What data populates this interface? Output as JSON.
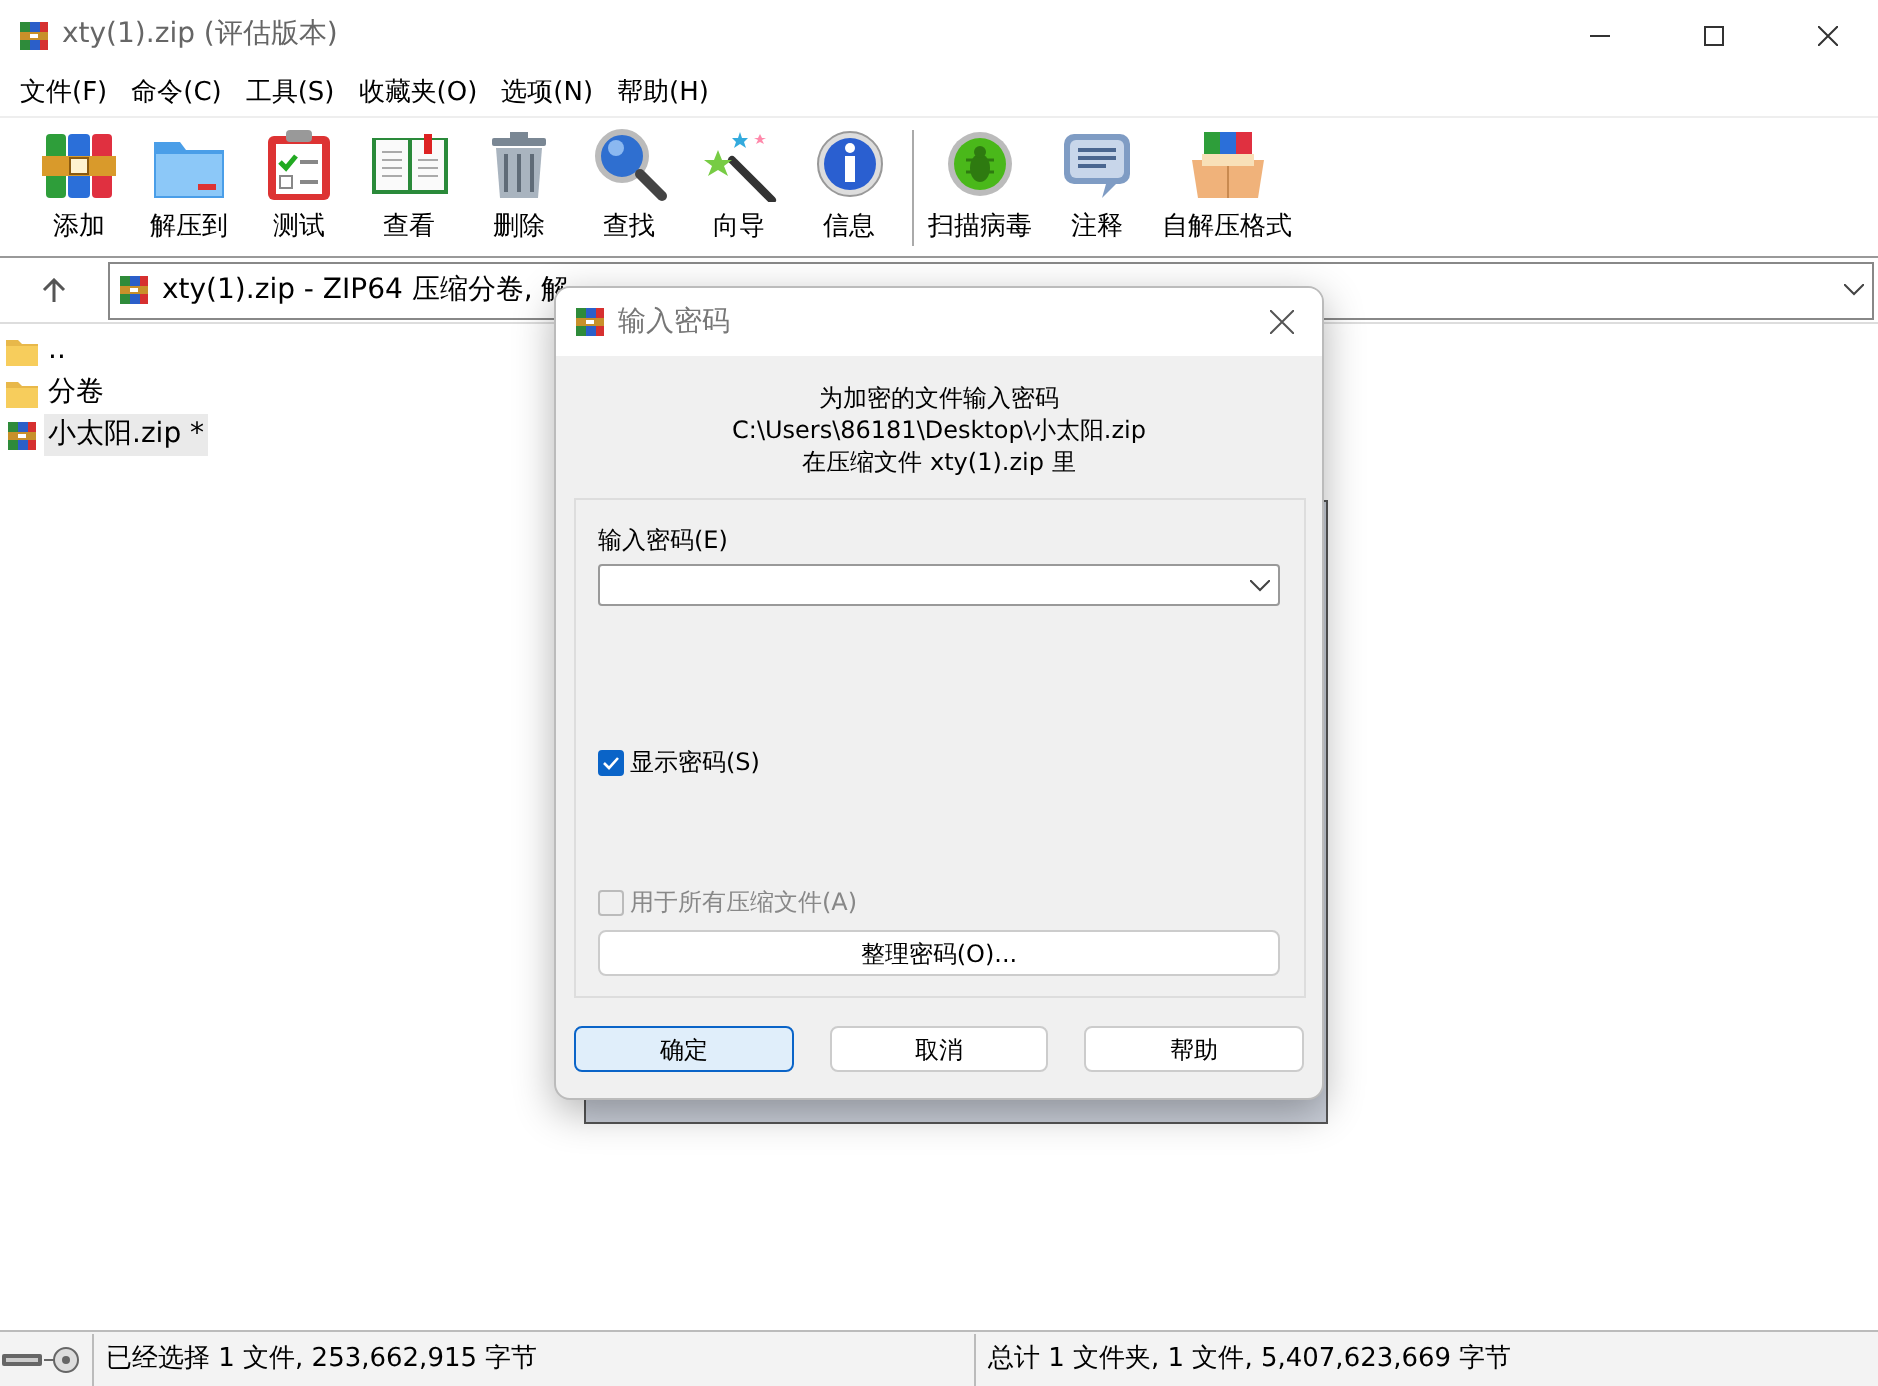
{
  "window": {
    "title": "xty(1).zip (评估版本)"
  },
  "menu": [
    "文件(F)",
    "命令(C)",
    "工具(S)",
    "收藏夹(O)",
    "选项(N)",
    "帮助(H)"
  ],
  "toolbar": [
    {
      "label": "添加",
      "separator_before": false
    },
    {
      "label": "解压到",
      "separator_before": false
    },
    {
      "label": "测试",
      "separator_before": false
    },
    {
      "label": "查看",
      "separator_before": false
    },
    {
      "label": "删除",
      "separator_before": false
    },
    {
      "label": "查找",
      "separator_before": false
    },
    {
      "label": "向导",
      "separator_before": false
    },
    {
      "label": "信息",
      "separator_before": false
    },
    {
      "label": "扫描病毒",
      "separator_before": true
    },
    {
      "label": "注释",
      "separator_before": false
    },
    {
      "label": "自解压格式",
      "separator_before": false
    }
  ],
  "address_bar": {
    "text": "xty(1).zip - ZIP64 压缩分卷, 解"
  },
  "files": [
    {
      "name": "..",
      "kind": "folder",
      "selected": false
    },
    {
      "name": "分卷",
      "kind": "folder",
      "selected": false
    },
    {
      "name": "小太阳.zip *",
      "kind": "archive",
      "selected": true
    }
  ],
  "dialog": {
    "title": "输入密码",
    "message_lines": [
      "为加密的文件输入密码",
      "C:\\Users\\86181\\Desktop\\小太阳.zip",
      "在压缩文件 xty(1).zip 里"
    ],
    "password_label": "输入密码(E)",
    "checkboxes": [
      {
        "label": "显示密码(S)",
        "checked": true,
        "disabled": false
      },
      {
        "label": "用于所有压缩文件(A)",
        "checked": false,
        "disabled": true
      }
    ],
    "organize_button": "整理密码(O)...",
    "buttons": [
      {
        "label": "确定",
        "default": true
      },
      {
        "label": "取消",
        "default": false
      },
      {
        "label": "帮助",
        "default": false
      }
    ]
  },
  "status_bar": {
    "left": "已经选择 1 文件, 253,662,915 字节",
    "right": "总计 1 文件夹, 1 文件, 5,407,623,669 字节"
  }
}
